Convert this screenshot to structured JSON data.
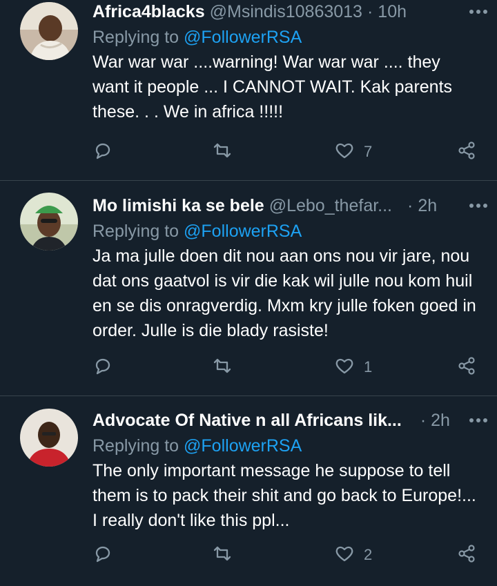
{
  "tweets": [
    {
      "name": "Africa4blacks",
      "handle": "@Msindis10863013",
      "time": "10h",
      "replying_prefix": "Replying to",
      "replying_to": "@FollowerRSA",
      "text": "War war war ....warning! War war war .... they want it people ... I CANNOT WAIT. Kak parents these. . . We in africa !!!!!",
      "likes": "7"
    },
    {
      "name": "Mo limishi ka se bele",
      "handle": "@Lebo_thefar...",
      "time": "2h",
      "replying_prefix": "Replying to",
      "replying_to": "@FollowerRSA",
      "text": "Ja ma julle doen dit nou aan ons nou vir jare, nou dat ons gaatvol is vir die kak wil julle nou kom huil en se dis onragverdig. Mxm kry julle foken goed in order. Julle is die blady rasiste!",
      "likes": "1"
    },
    {
      "name": "Advocate Of Native n all Africans lik...",
      "handle": "",
      "time": "2h",
      "replying_prefix": "Replying to",
      "replying_to": "@FollowerRSA",
      "text": "The only important message he suppose to tell them is to pack their shit and go back to Europe!... I really don't like this ppl...",
      "likes": "2"
    }
  ],
  "icons": {
    "reply": "comment-icon",
    "retweet": "retweet-icon",
    "like": "heart-icon",
    "share": "share-icon",
    "more": "more-dots-icon"
  },
  "colors": {
    "background": "#15202b",
    "secondary_text": "#8899a6",
    "link": "#1da1f2",
    "divider": "#38444d"
  }
}
